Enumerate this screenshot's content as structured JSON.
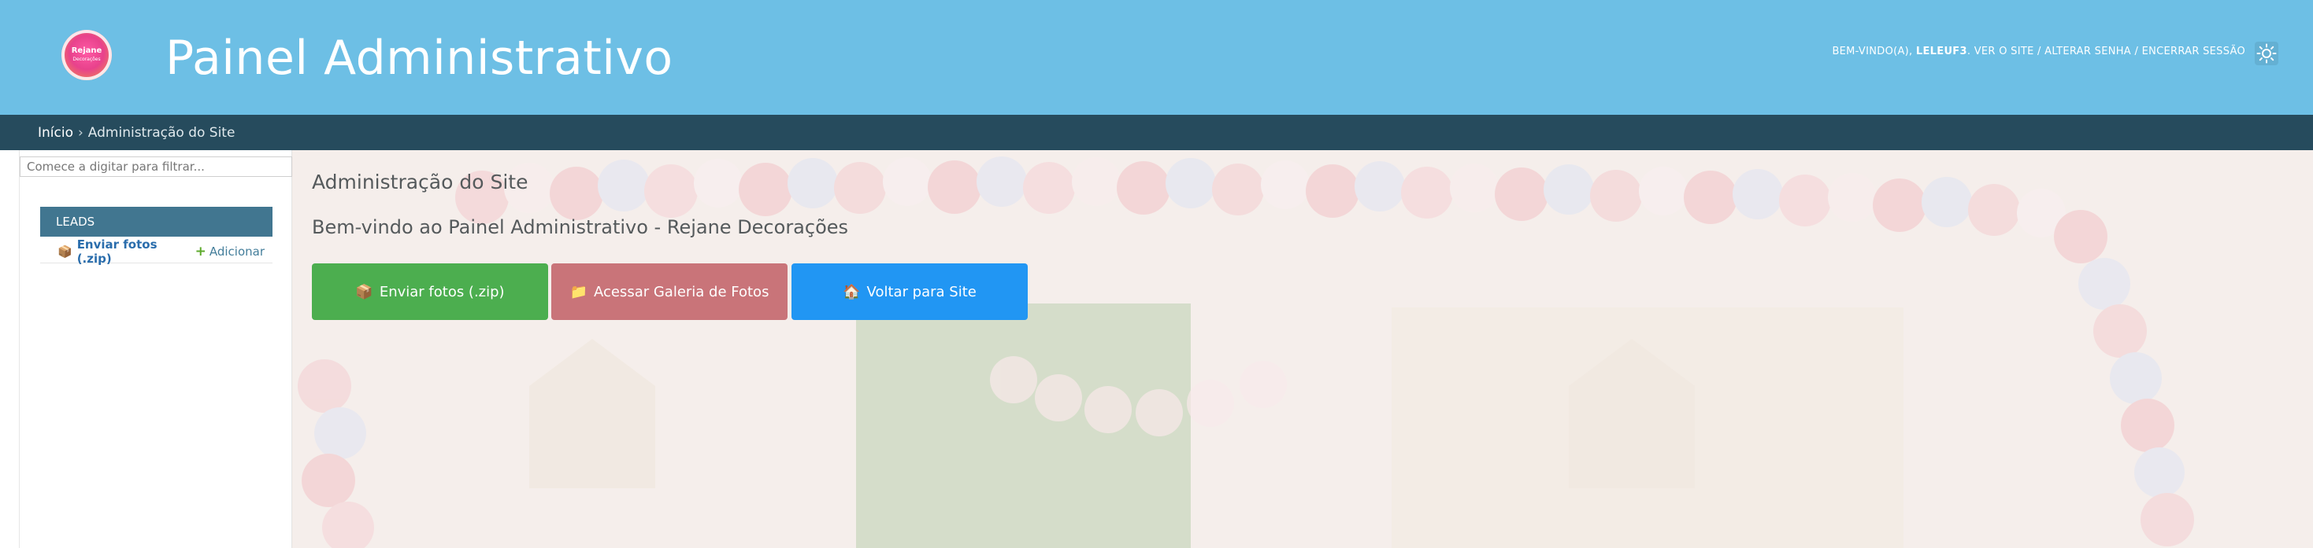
{
  "header": {
    "logo_text_1": "Rejane",
    "logo_text_2": "Decorações",
    "site_title": "Painel Administrativo",
    "user_tools": {
      "welcome_prefix": "BEM-VINDO(A),",
      "username": "LELEUF3",
      "view_site": "VER O SITE",
      "change_password": "ALTERAR SENHA",
      "logout": "ENCERRAR SESSÃO",
      "separator": "/"
    },
    "theme_icon": "sun-icon"
  },
  "breadcrumbs": {
    "home": "Início",
    "separator": "›",
    "current": "Administração do Site"
  },
  "sidebar": {
    "filter_placeholder": "Comece a digitar para filtrar...",
    "module": {
      "caption": "LEADS",
      "model_icon": "📦",
      "model_name": "Enviar fotos (.zip)",
      "add_label": "Adicionar"
    }
  },
  "main": {
    "title": "Administração do Site",
    "welcome": "Bem-vindo ao Painel Administrativo - Rejane Decorações",
    "buttons": [
      {
        "icon": "📦",
        "label": "Enviar fotos (.zip)",
        "color": "#4cae4f"
      },
      {
        "icon": "📁",
        "label": "Acessar Galeria de Fotos",
        "color": "#c97479"
      },
      {
        "icon": "🏠",
        "label": "Voltar para Site",
        "color": "#2196f3"
      }
    ]
  },
  "colors": {
    "header_bg": "#6dbfe5",
    "breadcrumb_bg": "#264b5d",
    "module_caption_bg": "#417690"
  }
}
